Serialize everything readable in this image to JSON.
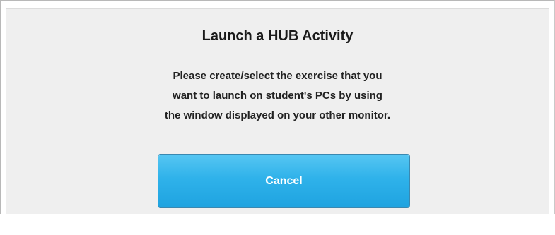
{
  "dialog": {
    "title": "Launch a HUB Activity",
    "message_lines": [
      "Please create/select the exercise that you",
      "want to launch on student's PCs by using",
      "the window displayed on your other monitor."
    ],
    "cancel_label": "Cancel"
  },
  "colors": {
    "dialog_background": "#efefef",
    "button_blue": "#2fb2ea",
    "button_text": "#ffffff"
  }
}
